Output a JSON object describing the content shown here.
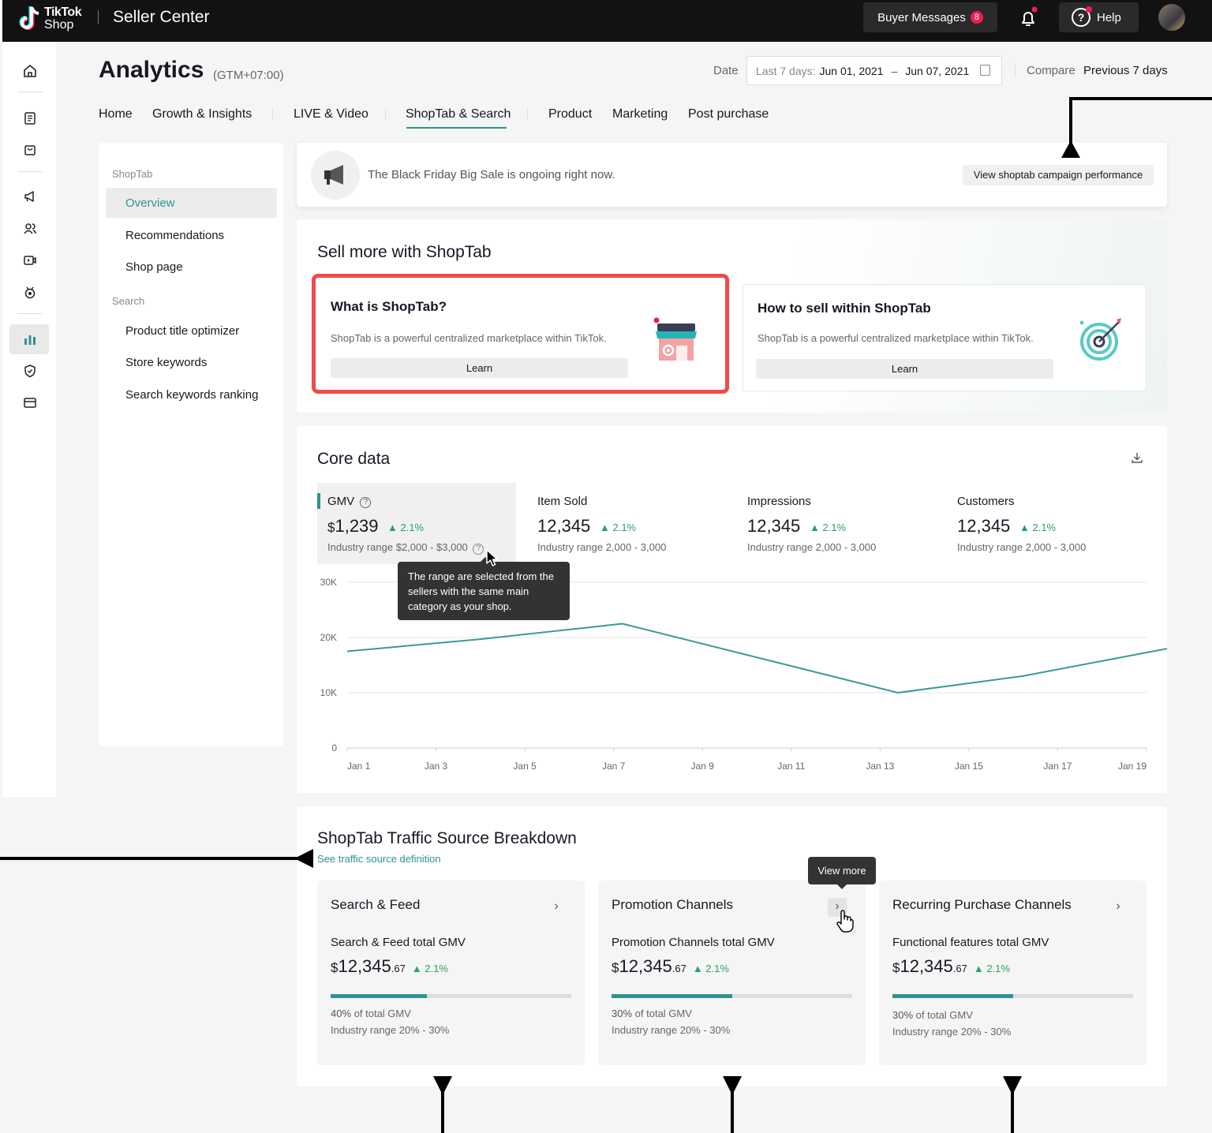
{
  "topbar": {
    "logo_line1": "TikTok",
    "logo_line2": "Shop",
    "app_title": "Seller Center",
    "buyer_messages_label": "Buyer Messages",
    "buyer_messages_count": "8",
    "help_label": "Help"
  },
  "rail": {
    "icons": [
      "home-icon",
      "orders-icon",
      "products-icon",
      "marketing-icon",
      "customers-icon",
      "live-video-icon",
      "badge-icon",
      "analytics-icon",
      "shield-icon",
      "finance-icon"
    ],
    "active": "analytics-icon"
  },
  "header": {
    "title": "Analytics",
    "timezone": "(GTM+07:00)",
    "date_label": "Date",
    "date_prefix": "Last 7 days:",
    "date_start": "Jun 01, 2021",
    "date_sep": "–",
    "date_end": "Jun 07, 2021",
    "compare_label": "Compare",
    "compare_value": "Previous 7 days"
  },
  "tabs": [
    {
      "label": "Home"
    },
    {
      "label": "Growth & Insights"
    },
    {
      "label": "LIVE & Video"
    },
    {
      "label": "ShopTab & Search",
      "active": true
    },
    {
      "label": "Product"
    },
    {
      "label": "Marketing"
    },
    {
      "label": "Post purchase"
    }
  ],
  "sidebar": {
    "group1": "ShopTab",
    "items1": [
      "Overview",
      "Recommendations",
      "Shop page"
    ],
    "group2": "Search",
    "items2": [
      "Product title optimizer",
      "Store keywords",
      "Search keywords ranking"
    ],
    "active": "Overview"
  },
  "banner": {
    "text": "The Black Friday Big Sale is ongoing right now.",
    "button": "View shoptab campaign performance"
  },
  "sell": {
    "title": "Sell more with ShopTab",
    "cards": [
      {
        "title": "What is ShopTab?",
        "desc": "ShopTab is a powerful centralized marketplace within TikTok.",
        "button": "Learn",
        "icon": "storefront-icon"
      },
      {
        "title": "How to sell within ShopTab",
        "desc": "ShopTab is a powerful centralized marketplace within TikTok.",
        "button": "Learn",
        "icon": "target-icon"
      }
    ]
  },
  "core": {
    "title": "Core data",
    "metrics": [
      {
        "label": "GMV",
        "currency": "$",
        "value": "1,239",
        "delta": "2.1%",
        "range": "Industry range $2,000 - $3,000"
      },
      {
        "label": "Item Sold",
        "value": "12,345",
        "delta": "2.1%",
        "range": "Industry range 2,000 - 3,000"
      },
      {
        "label": "Impressions",
        "value": "12,345",
        "delta": "2.1%",
        "range": "Industry range 2,000 - 3,000"
      },
      {
        "label": "Customers",
        "value": "12,345",
        "delta": "2.1%",
        "range": "Industry range 2,000 - 3,000"
      }
    ],
    "tooltip": "The range are selected from the sellers with the same main category as your shop."
  },
  "chart_data": {
    "type": "line",
    "x": [
      "Jan 1",
      "Jan 3",
      "Jan 5",
      "Jan 7",
      "Jan 9",
      "Jan 11",
      "Jan 13",
      "Jan 15",
      "Jan 17",
      "Jan 19"
    ],
    "series": [
      {
        "values": [
          17500,
          19700,
          22500,
          10000,
          13000,
          18500
        ],
        "x_index": [
          0,
          1.5,
          3.1,
          6.2,
          7.6,
          9.4
        ]
      }
    ],
    "yticks": [
      "30K",
      "20K",
      "10K",
      "0"
    ],
    "ylim": [
      0,
      30000
    ],
    "color": "#3a9a96",
    "grid": true
  },
  "traffic": {
    "title": "ShopTab Traffic Source Breakdown",
    "link": "See traffic source definition",
    "view_more": "View more",
    "cards": [
      {
        "title": "Search & Feed",
        "sub": "Search & Feed total GMV",
        "cur": "$",
        "val": "12,345",
        "cents": ".67",
        "delta": "2.1%",
        "pct": 0.4,
        "pct_label": "40%",
        "pct_text": "of total GMV",
        "range": "Industry range 20% - 30%"
      },
      {
        "title": "Promotion Channels",
        "sub": "Promotion Channels total GMV",
        "cur": "$",
        "val": "12,345",
        "cents": ".67",
        "delta": "2.1%",
        "pct": 0.5,
        "pct_label": "30%",
        "pct_text": "of total GMV",
        "range": "Industry range 20% - 30%"
      },
      {
        "title": "Recurring Purchase Channels",
        "sub": "Functional features total GMV",
        "cur": "$",
        "val": "12,345",
        "cents": ".67",
        "delta": "2.1%",
        "pct": 0.5,
        "pct_label": "30%",
        "pct_text": "of total GMV",
        "range": "Industry range 20% - 30%"
      }
    ]
  }
}
